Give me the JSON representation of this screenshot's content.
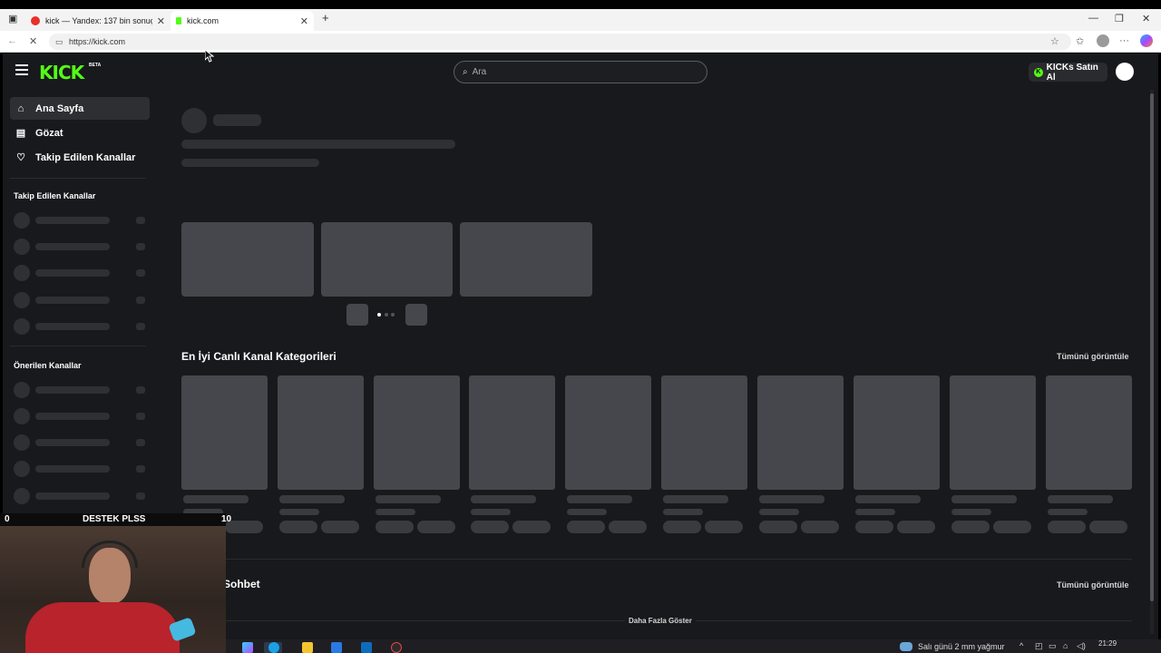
{
  "browser": {
    "tabs": [
      {
        "title": "kick — Yandex: 137 bin sonuç bu",
        "favicon_color": "#e8302b"
      },
      {
        "title": "kick.com",
        "favicon_color": "#53fc18"
      }
    ],
    "url": "https://kick.com"
  },
  "site": {
    "logo": "KICK",
    "logo_badge": "BETA",
    "search_placeholder": "Ara",
    "kicks_button": "KICKs Satın Al",
    "accent": "#53fc18"
  },
  "sidebar": {
    "nav": [
      {
        "label": "Ana Sayfa",
        "icon": "home-icon"
      },
      {
        "label": "Gözat",
        "icon": "browse-icon"
      },
      {
        "label": "Takip Edilen Kanallar",
        "icon": "heart-icon"
      }
    ],
    "followed_heading": "Takip Edilen Kanallar",
    "recommended_heading": "Önerilen Kanallar"
  },
  "main": {
    "categories_title": "En İyi Canlı Kanal Kategorileri",
    "categories_see_all": "Tümünü görüntüle",
    "chat_title": "Sohbet",
    "chat_see_all": "Tümünü görüntüle",
    "show_more": "Daha Fazla Göster"
  },
  "overlay": {
    "left_num": "0",
    "banner": "DESTEK PLSS",
    "right_num": "10"
  },
  "taskbar": {
    "weather": "Salı günü 2 mm yağmur",
    "time": "21:29"
  }
}
